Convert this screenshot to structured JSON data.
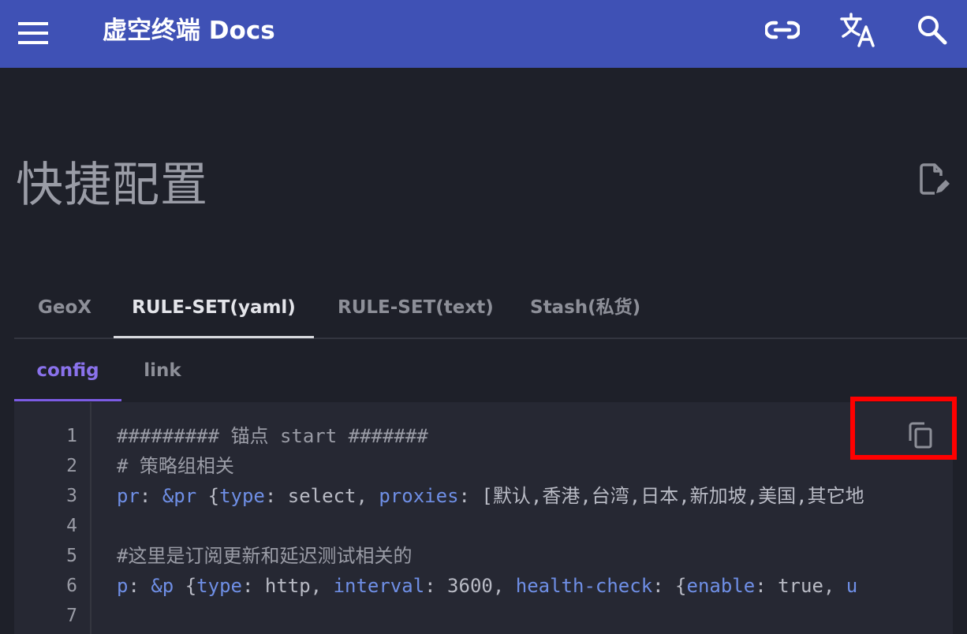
{
  "header": {
    "title": "虚空终端 Docs",
    "menu_icon": "menu-icon",
    "link_icon": "link-icon",
    "translate_icon": "translate-icon",
    "search_icon": "search-icon"
  },
  "page": {
    "title": "快捷配置",
    "edit_icon": "edit-page-icon"
  },
  "tabs": [
    {
      "label": "GeoX",
      "active": false
    },
    {
      "label": "RULE-SET(yaml)",
      "active": true
    },
    {
      "label": "RULE-SET(text)",
      "active": false
    },
    {
      "label": "Stash(私货)",
      "active": false
    }
  ],
  "subtabs": [
    {
      "label": "config",
      "active": true
    },
    {
      "label": "link",
      "active": false
    }
  ],
  "code": {
    "line_numbers": [
      "1",
      "2",
      "3",
      "4",
      "5",
      "6",
      "7"
    ],
    "lines": [
      [
        {
          "t": "######### 锚点 start #######",
          "c": "c-comment"
        }
      ],
      [
        {
          "t": "# 策略组相关",
          "c": "c-comment"
        }
      ],
      [
        {
          "t": "pr",
          "c": "c-key"
        },
        {
          "t": ": ",
          "c": "c-punct"
        },
        {
          "t": "&pr",
          "c": "c-anchor"
        },
        {
          "t": " {",
          "c": "c-punct"
        },
        {
          "t": "type",
          "c": "c-key"
        },
        {
          "t": ": select, ",
          "c": "c-val"
        },
        {
          "t": "proxies",
          "c": "c-key"
        },
        {
          "t": ": [默认,香港,台湾,日本,新加坡,美国,其它地",
          "c": "c-val"
        }
      ],
      [],
      [
        {
          "t": "#这里是订阅更新和延迟测试相关的",
          "c": "c-comment"
        }
      ],
      [
        {
          "t": "p",
          "c": "c-key"
        },
        {
          "t": ": ",
          "c": "c-punct"
        },
        {
          "t": "&p",
          "c": "c-anchor"
        },
        {
          "t": " {",
          "c": "c-punct"
        },
        {
          "t": "type",
          "c": "c-key"
        },
        {
          "t": ": http, ",
          "c": "c-val"
        },
        {
          "t": "interval",
          "c": "c-key"
        },
        {
          "t": ": 3600, ",
          "c": "c-val"
        },
        {
          "t": "health-check",
          "c": "c-key"
        },
        {
          "t": ": {",
          "c": "c-val"
        },
        {
          "t": "enable",
          "c": "c-key"
        },
        {
          "t": ": true, ",
          "c": "c-val"
        },
        {
          "t": "u",
          "c": "c-key"
        }
      ],
      []
    ],
    "copy_icon": "copy-icon"
  },
  "colors": {
    "appbar": "#3f51b5",
    "background": "#1e2029",
    "code_background": "#262833",
    "accent": "#7c5ce4",
    "highlight": "#ff0000"
  }
}
